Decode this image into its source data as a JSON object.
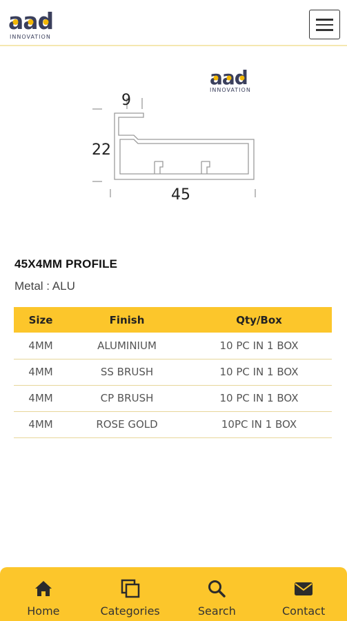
{
  "header": {
    "logo_text": "aad",
    "logo_subtext": "INNOVATION",
    "menu_icon": "hamburger-menu-icon"
  },
  "product_image": {
    "logo_text": "aad",
    "logo_subtext": "INNOVATION",
    "dim_top": "9",
    "dim_left": "22",
    "dim_bottom": "45"
  },
  "product": {
    "title": "45X4MM PROFILE",
    "metal": "Metal : ALU"
  },
  "spec_table": {
    "headers": [
      "Size",
      "Finish",
      "Qty/Box"
    ],
    "rows": [
      [
        "4MM",
        "ALUMINIUM",
        "10 PC IN 1 BOX"
      ],
      [
        "4MM",
        "SS BRUSH",
        "10 PC IN 1 BOX"
      ],
      [
        "4MM",
        "CP BRUSH",
        "10 PC IN 1 BOX"
      ],
      [
        "4MM",
        "ROSE GOLD",
        "10PC IN 1 BOX"
      ]
    ]
  },
  "bottom_nav": {
    "items": [
      {
        "label": "Home",
        "icon": "home-icon"
      },
      {
        "label": "Categories",
        "icon": "categories-icon"
      },
      {
        "label": "Search",
        "icon": "search-icon"
      },
      {
        "label": "Contact",
        "icon": "envelope-icon"
      }
    ]
  },
  "colors": {
    "accent": "#fcc62b",
    "logo_dark": "#3a3f5c",
    "logo_yellow": "#f2b705"
  }
}
